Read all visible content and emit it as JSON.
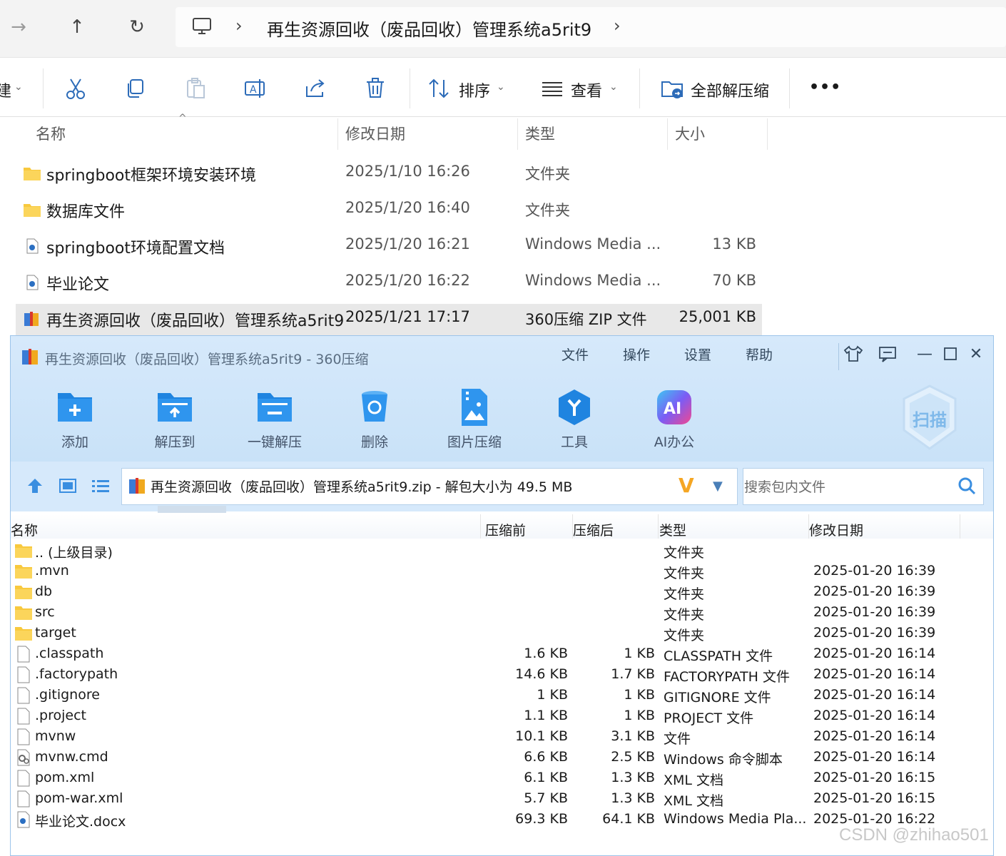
{
  "explorer": {
    "address_path": "再生资源回收（废品回收）管理系统a5rit9",
    "toolbar": {
      "new_partial": "建",
      "sort_label": "排序",
      "view_label": "查看",
      "extract_all_label": "全部解压缩",
      "more_label": "•••"
    },
    "columns": {
      "name": "名称",
      "modified": "修改日期",
      "type": "类型",
      "size": "大小"
    },
    "rows": [
      {
        "name": "springboot框架环境安装环境",
        "date": "2025/1/10 16:26",
        "type": "文件夹",
        "size": "",
        "icon": "folder-icon"
      },
      {
        "name": "数据库文件",
        "date": "2025/1/20 16:40",
        "type": "文件夹",
        "size": "",
        "icon": "folder-icon"
      },
      {
        "name": "springboot环境配置文档",
        "date": "2025/1/20 16:21",
        "type": "Windows Media ...",
        "size": "13 KB",
        "icon": "media-file-icon"
      },
      {
        "name": "毕业论文",
        "date": "2025/1/20 16:22",
        "type": "Windows Media ...",
        "size": "70 KB",
        "icon": "media-file-icon"
      },
      {
        "name": "再生资源回收（废品回收）管理系统a5rit9",
        "date": "2025/1/21 17:17",
        "type": "360压缩 ZIP 文件",
        "size": "25,001 KB",
        "icon": "zip-archive-icon",
        "selected": true
      }
    ]
  },
  "zip": {
    "title": "再生资源回收（废品回收）管理系统a5rit9 - 360压缩",
    "menu": [
      "文件",
      "操作",
      "设置",
      "帮助"
    ],
    "tools": [
      "添加",
      "解压到",
      "一键解压",
      "删除",
      "图片压缩",
      "工具",
      "AI办公"
    ],
    "scan_label": "扫描",
    "path_text": "再生资源回收（废品回收）管理系统a5rit9.zip - 解包大小为 49.5 MB",
    "path_badge": "V",
    "search_placeholder": "搜索包内文件",
    "columns": {
      "name": "名称",
      "before": "压缩前",
      "after": "压缩后",
      "type": "类型",
      "modified": "修改日期"
    },
    "rows": [
      {
        "name": ".. (上级目录)",
        "before": "",
        "after": "",
        "type": "文件夹",
        "date": "",
        "icon": "folder-icon"
      },
      {
        "name": ".mvn",
        "before": "",
        "after": "",
        "type": "文件夹",
        "date": "2025-01-20 16:39",
        "icon": "folder-icon"
      },
      {
        "name": "db",
        "before": "",
        "after": "",
        "type": "文件夹",
        "date": "2025-01-20 16:39",
        "icon": "folder-icon"
      },
      {
        "name": "src",
        "before": "",
        "after": "",
        "type": "文件夹",
        "date": "2025-01-20 16:39",
        "icon": "folder-icon"
      },
      {
        "name": "target",
        "before": "",
        "after": "",
        "type": "文件夹",
        "date": "2025-01-20 16:39",
        "icon": "folder-icon"
      },
      {
        "name": ".classpath",
        "before": "1.6 KB",
        "after": "1 KB",
        "type": "CLASSPATH 文件",
        "date": "2025-01-20 16:14",
        "icon": "file-icon"
      },
      {
        "name": ".factorypath",
        "before": "14.6 KB",
        "after": "1.7 KB",
        "type": "FACTORYPATH 文件",
        "date": "2025-01-20 16:14",
        "icon": "file-icon"
      },
      {
        "name": ".gitignore",
        "before": "1 KB",
        "after": "1 KB",
        "type": "GITIGNORE 文件",
        "date": "2025-01-20 16:14",
        "icon": "file-icon"
      },
      {
        "name": ".project",
        "before": "1.1 KB",
        "after": "1 KB",
        "type": "PROJECT 文件",
        "date": "2025-01-20 16:14",
        "icon": "file-icon"
      },
      {
        "name": "mvnw",
        "before": "10.1 KB",
        "after": "3.1 KB",
        "type": "文件",
        "date": "2025-01-20 16:14",
        "icon": "file-icon"
      },
      {
        "name": "mvnw.cmd",
        "before": "6.6 KB",
        "after": "2.5 KB",
        "type": "Windows 命令脚本",
        "date": "2025-01-20 16:14",
        "icon": "script-file-icon"
      },
      {
        "name": "pom.xml",
        "before": "6.1 KB",
        "after": "1.3 KB",
        "type": "XML 文档",
        "date": "2025-01-20 16:15",
        "icon": "file-icon"
      },
      {
        "name": "pom-war.xml",
        "before": "5.7 KB",
        "after": "1.3 KB",
        "type": "XML 文档",
        "date": "2025-01-20 16:15",
        "icon": "file-icon"
      },
      {
        "name": "毕业论文.docx",
        "before": "69.3 KB",
        "after": "64.1 KB",
        "type": "Windows Media Pla...",
        "date": "2025-01-20 16:22",
        "icon": "media-file-icon"
      }
    ]
  },
  "watermark": "CSDN @zhihao501"
}
